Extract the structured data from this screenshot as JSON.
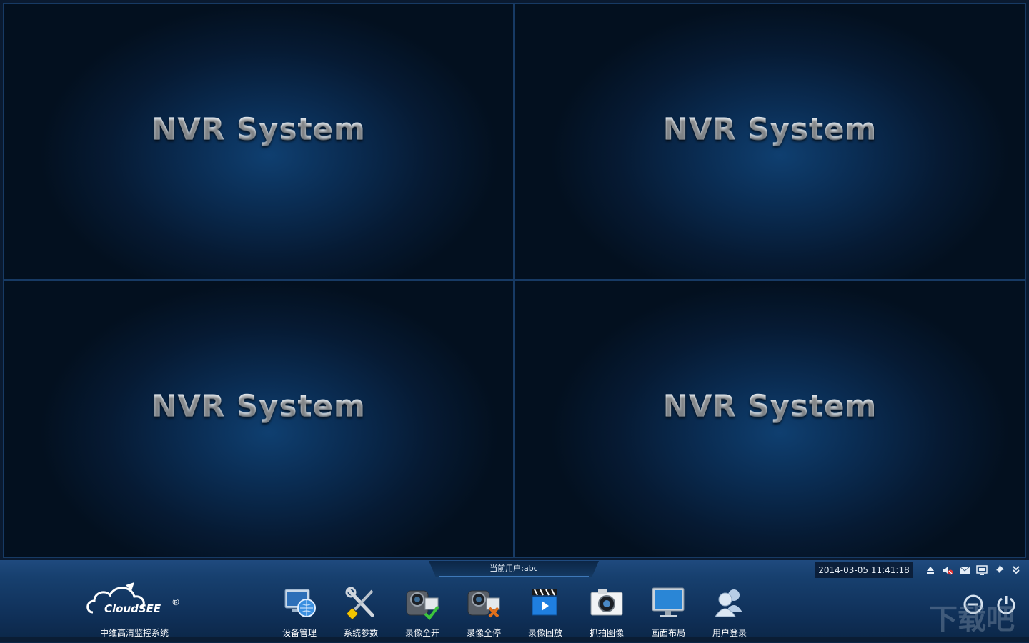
{
  "video_cells": [
    {
      "title": "NVR System"
    },
    {
      "title": "NVR System"
    },
    {
      "title": "NVR System"
    },
    {
      "title": "NVR System"
    }
  ],
  "status": {
    "current_user": "当前用户:abc",
    "datetime": "2014-03-05 11:41:18"
  },
  "logo": {
    "brand": "CloudSEE",
    "registered": "®",
    "caption": "中维高清监控系统"
  },
  "tools": [
    {
      "label": "设备管理",
      "icon": "device-management-icon"
    },
    {
      "label": "系统参数",
      "icon": "system-settings-icon"
    },
    {
      "label": "录像全开",
      "icon": "record-all-start-icon"
    },
    {
      "label": "录像全停",
      "icon": "record-all-stop-icon"
    },
    {
      "label": "录像回放",
      "icon": "playback-icon"
    },
    {
      "label": "抓拍图像",
      "icon": "snapshot-icon"
    },
    {
      "label": "画面布局",
      "icon": "layout-icon"
    },
    {
      "label": "用户登录",
      "icon": "user-login-icon"
    }
  ],
  "system_icons": [
    "eject-icon",
    "mute-icon",
    "mail-icon",
    "screen-icon",
    "pin-icon",
    "expand-down-icon"
  ],
  "watermark": "下载吧",
  "colors": {
    "accent": "#1f4a7e",
    "cell_bg": "#0a2c52",
    "text": "#ffffff"
  }
}
